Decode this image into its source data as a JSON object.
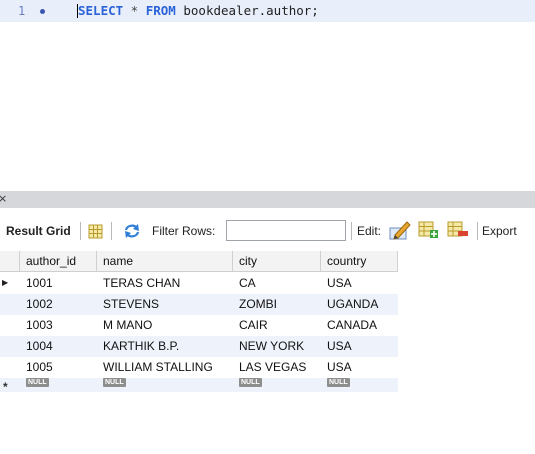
{
  "editor": {
    "line_number": "1",
    "code_keyword_select": "SELECT",
    "code_star": " * ",
    "code_keyword_from": "FROM",
    "code_rest": " bookdealer.author;"
  },
  "panel": {
    "close_glyph": "×"
  },
  "toolbar": {
    "result_grid_label": "Result Grid",
    "filter_rows_label": "Filter Rows:",
    "filter_value": "",
    "edit_label": "Edit:",
    "export_label": "Export"
  },
  "grid": {
    "columns": [
      "author_id",
      "name",
      "city",
      "country"
    ],
    "rows": [
      [
        "1001",
        "TERAS CHAN",
        "CA",
        "USA"
      ],
      [
        "1002",
        "STEVENS",
        "ZOMBI",
        "UGANDA"
      ],
      [
        "1003",
        "M MANO",
        "CAIR",
        "CANADA"
      ],
      [
        "1004",
        "KARTHIK B.P.",
        "NEW YORK",
        "USA"
      ],
      [
        "1005",
        "WILLIAM STALLING",
        "LAS VEGAS",
        "USA"
      ]
    ],
    "null_label": "NULL",
    "current_row_marker": "▶",
    "new_row_marker": "*"
  },
  "colors": {
    "editor_line_bg": "#e9eefb",
    "keyword": "#2a63d8",
    "row_alt": "#edf2fb",
    "null_badge": "#8e8e8e"
  },
  "icons": [
    "grid-toggle-icon",
    "refresh-icon",
    "edit-row-icon",
    "add-row-icon",
    "delete-row-icon",
    "close-icon"
  ]
}
